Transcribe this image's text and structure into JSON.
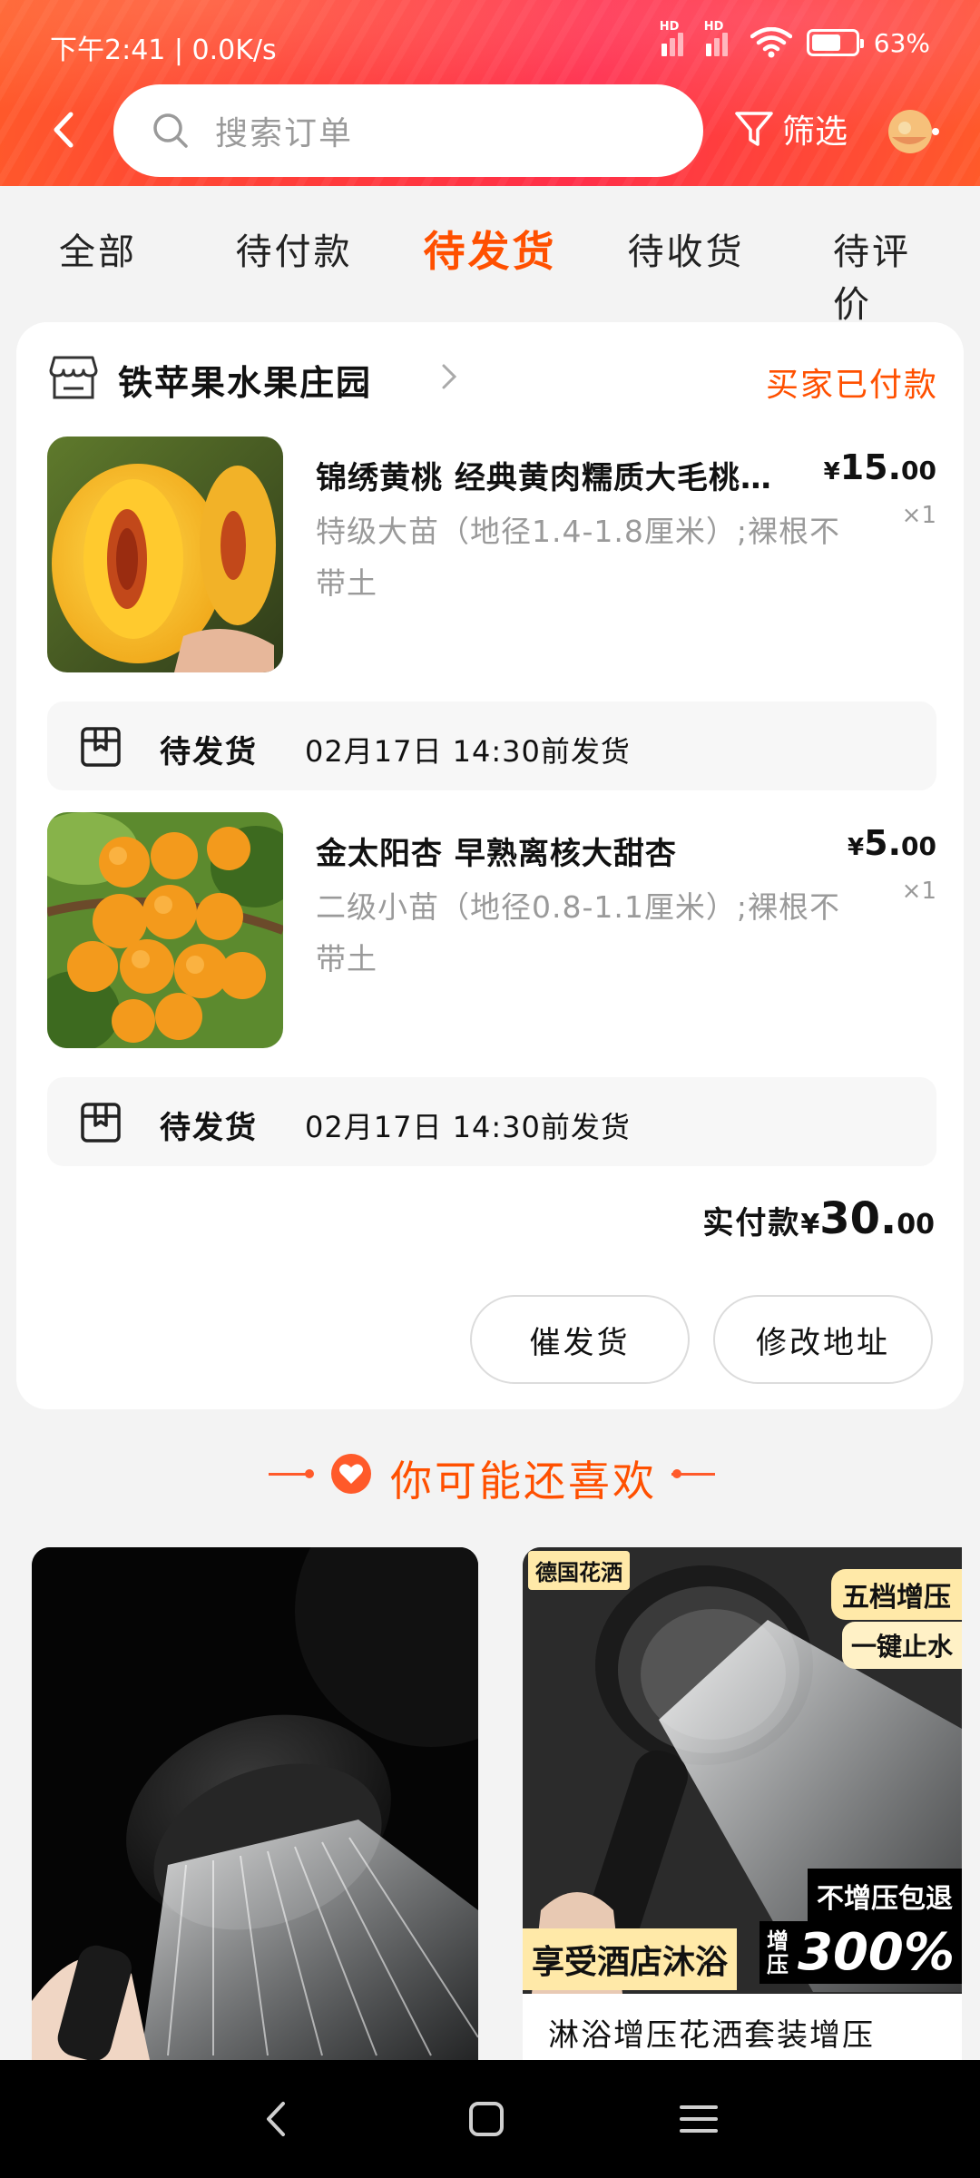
{
  "status_bar": {
    "time_speed": "下午2:41 | 0.0K/s",
    "hd1": "HD",
    "hd2": "HD",
    "battery": "63%"
  },
  "header": {
    "search_placeholder": "搜索订单",
    "filter_label": "筛选",
    "back_icon": "chevron-left-icon",
    "search_icon": "magnifier-icon",
    "filter_icon": "funnel-icon",
    "accent": "#ff5000"
  },
  "tabs": [
    {
      "label": "全部",
      "active": false
    },
    {
      "label": "待付款",
      "active": false
    },
    {
      "label": "待发货",
      "active": true
    },
    {
      "label": "待收货",
      "active": false
    },
    {
      "label": "待评价",
      "active": false
    }
  ],
  "order": {
    "shop_name": "铁苹果水果庄园",
    "status": "买家已付款",
    "items": [
      {
        "title": "锦绣黄桃 经典黄肉糯质大毛桃…",
        "sku": "特级大苗（地径1.4-1.8厘米）;裸根不带土",
        "price_cur": "¥",
        "price_int": "15.",
        "price_dec": "00",
        "qty": "×1",
        "ship_status": "待发货",
        "ship_time": "02月17日  14:30前发货"
      },
      {
        "title": "金太阳杏  早熟离核大甜杏",
        "sku": "二级小苗（地径0.8-1.1厘米）;裸根不带土",
        "price_cur": "¥",
        "price_int": "5.",
        "price_dec": "00",
        "qty": "×1",
        "ship_status": "待发货",
        "ship_time": "02月17日  14:30前发货"
      }
    ],
    "total_label": "实付款",
    "total_cur": "¥",
    "total_int": "30.",
    "total_dec": "00",
    "buttons": {
      "urge": "催发货",
      "address": "修改地址"
    }
  },
  "recommend": {
    "title": "你可能还喜欢",
    "right_card": {
      "tag_brand": "德国花洒",
      "tag_five": "五档增压",
      "tag_onekey": "一键止水",
      "tag_nobad": "不增压包退",
      "tag_hotel": "享受酒店沐浴",
      "tag_zy": "增压",
      "tag_pct": "300%",
      "title": "淋浴增压花洒套装增压"
    }
  },
  "navbar": {
    "back_icon": "nav-back-icon",
    "home_icon": "nav-home-icon",
    "menu_icon": "nav-menu-icon"
  }
}
